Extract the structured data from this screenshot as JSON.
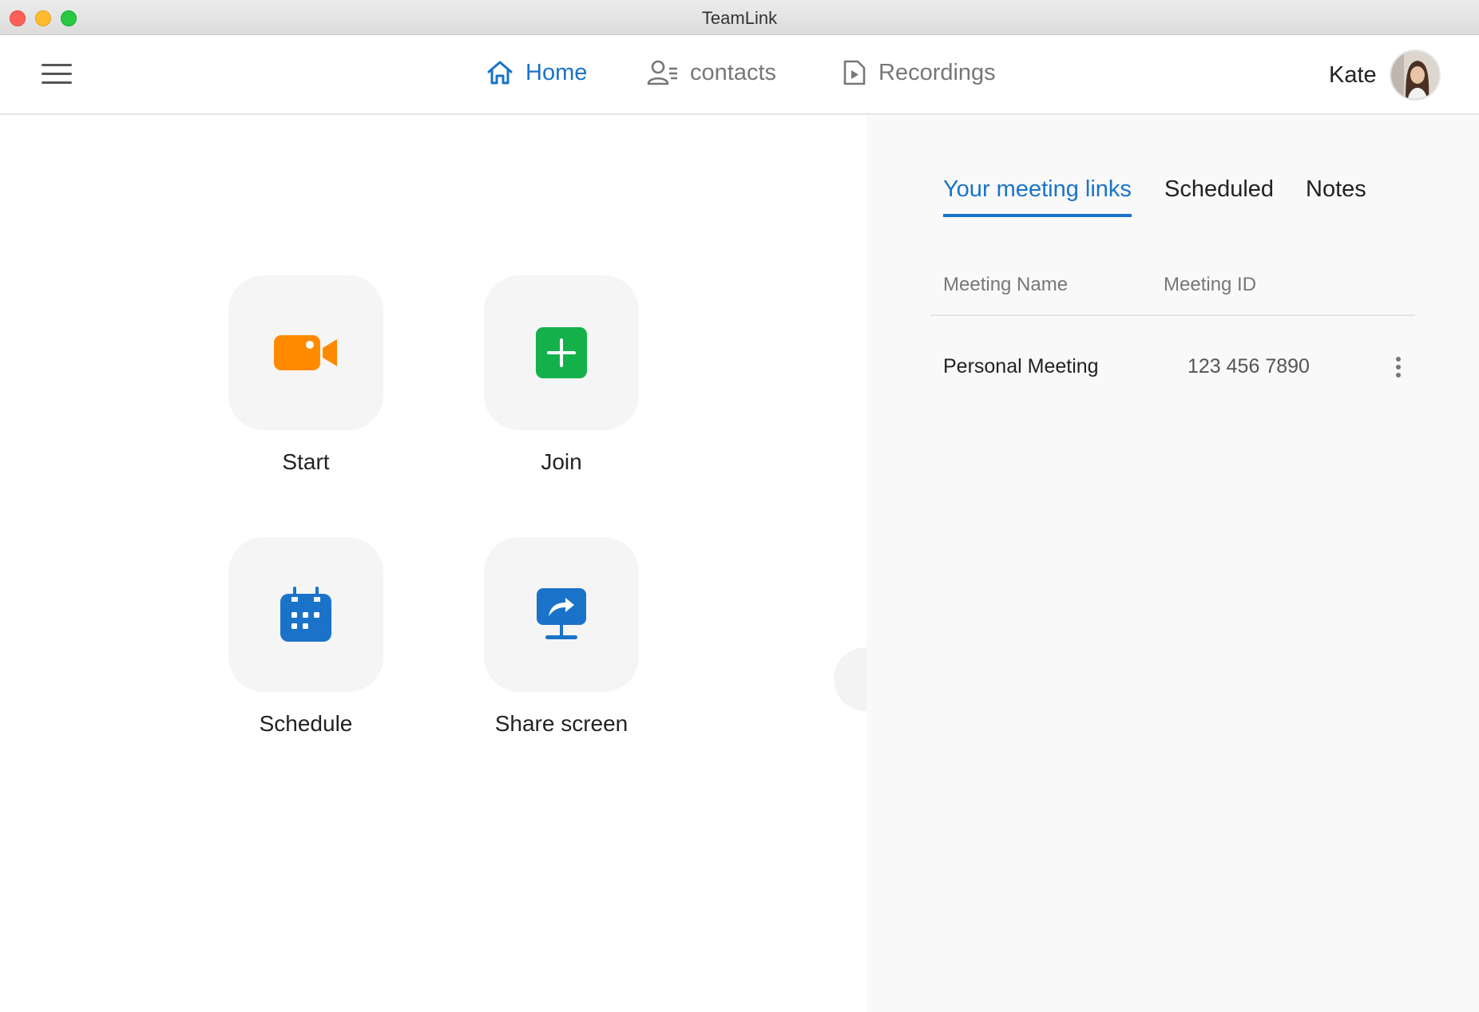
{
  "window": {
    "title": "TeamLink"
  },
  "nav": {
    "home_label": "Home",
    "contacts_label": "contacts",
    "recordings_label": "Recordings",
    "active": "home"
  },
  "user": {
    "name": "Kate"
  },
  "actions": {
    "start_label": "Start",
    "join_label": "Join",
    "schedule_label": "Schedule",
    "share_label": "Share screen"
  },
  "right_panel": {
    "tabs": [
      {
        "label": "Your meeting links",
        "active": true
      },
      {
        "label": "Scheduled",
        "active": false
      },
      {
        "label": "Notes",
        "active": false
      }
    ],
    "columns": {
      "name": "Meeting Name",
      "id": "Meeting ID"
    },
    "rows": [
      {
        "name": "Personal Meeting",
        "id": "123 456 7890"
      }
    ]
  },
  "icons": {
    "menu": "hamburger-icon",
    "home": "home-icon",
    "contacts": "contacts-icon",
    "recordings": "recordings-icon",
    "start": "video-camera-icon",
    "join": "plus-icon",
    "schedule": "calendar-icon",
    "share": "share-screen-icon",
    "collapse": "chevron-right-icon",
    "more": "more-vertical-icon"
  },
  "colors": {
    "accent": "#1a73c9",
    "start": "#ff8a00",
    "join": "#14b14b",
    "schedule": "#1a73c9",
    "share": "#1a73c9"
  }
}
